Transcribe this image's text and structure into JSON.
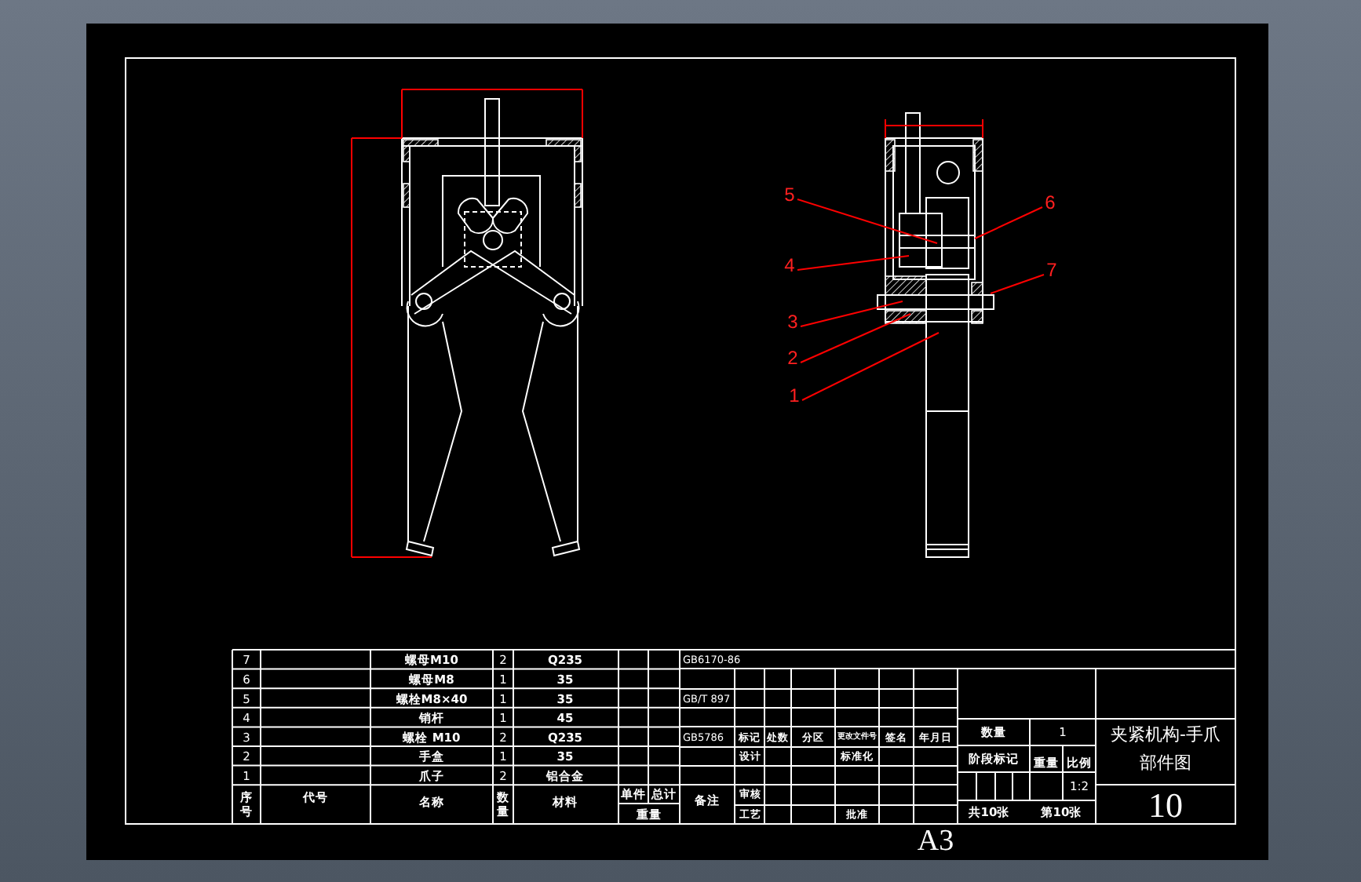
{
  "side_view": {
    "balloons": [
      "5",
      "6",
      "4",
      "7",
      "3",
      "2",
      "1"
    ]
  },
  "parts_list": {
    "columns": {
      "no": "序号",
      "code": "代号",
      "name": "名称",
      "qty": "数量",
      "material": "材料",
      "unit": "单件",
      "total": "总计",
      "weight": "重量",
      "remarks": "备注"
    },
    "rows": [
      {
        "no": "7",
        "name": "螺母M10",
        "qty": "2",
        "material": "Q235",
        "remarks": "GB6170-86"
      },
      {
        "no": "6",
        "name": "螺母M8",
        "qty": "1",
        "material": "35"
      },
      {
        "no": "5",
        "name": "螺栓M8×40",
        "qty": "1",
        "material": "35",
        "remarks": "GB/T 897"
      },
      {
        "no": "4",
        "name": "销杆",
        "qty": "1",
        "material": "45"
      },
      {
        "no": "3",
        "name": "螺栓 M10",
        "qty": "2",
        "material": "Q235",
        "remarks": "GB5786"
      },
      {
        "no": "2",
        "name": "手盒",
        "qty": "1",
        "material": "35"
      },
      {
        "no": "1",
        "name": "爪子",
        "qty": "2",
        "material": "铝合金"
      }
    ]
  },
  "title_block": {
    "revision_headers": [
      "标记",
      "处数",
      "分区",
      "更改文件号",
      "签名",
      "年月日"
    ],
    "signatures": [
      "设计",
      "标准化",
      "审核",
      "工艺",
      "批准"
    ],
    "quantity_label": "数量",
    "quantity": "1",
    "stage_label": "阶段标记",
    "weight_label": "重量",
    "scale_label": "比例",
    "scale": "1:2",
    "sheet_count": "共10张",
    "sheet_index": "第10张",
    "title_lines": [
      "夹紧机构-手爪",
      "部件图"
    ],
    "drawing_number": "10"
  },
  "sheet_size": "A3"
}
